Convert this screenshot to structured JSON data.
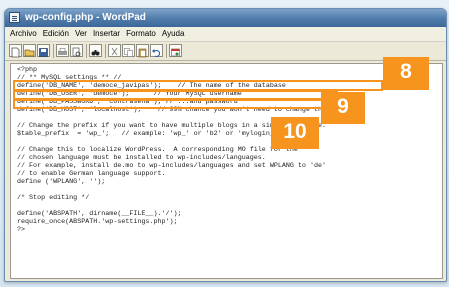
{
  "window": {
    "title": "wp-config.php - WordPad"
  },
  "menu": [
    "Archivo",
    "Edición",
    "Ver",
    "Insertar",
    "Formato",
    "Ayuda"
  ],
  "toolbar": {
    "icons": [
      "new-document-icon",
      "open-folder-icon",
      "save-icon",
      "print-icon",
      "print-preview-icon",
      "find-icon",
      "cut-icon",
      "copy-icon",
      "paste-icon",
      "undo-icon",
      "date-time-icon"
    ]
  },
  "code": {
    "lines": [
      "<?php",
      "// ** MySQL settings ** //",
      "define('DB_NAME', 'democe_javipas');    // The name of the database",
      "define('DB_USER', 'democe');      // Your MySQL username",
      "define('DB_PASSWORD', 'contraseña'); // ...and password",
      "define('DB_HOST', 'localhost');    // 99% chance you won't need to change this",
      "",
      "// Change the prefix if you want to have multiple blogs in a single database.",
      "$table_prefix  = 'wp_';   // example: 'wp_' or 'b2' or 'mylogin_'",
      "",
      "// Change this to localize WordPress.  A corresponding MO file for the",
      "// chosen language must be installed to wp-includes/languages.",
      "// For example, install de.mo to wp-includes/languages and set WPLANG to 'de'",
      "// to enable German language support.",
      "define ('WPLANG', '');",
      "",
      "/* Stop editing */",
      "",
      "define('ABSPATH', dirname(__FILE__).'/');",
      "require_once(ABSPATH.'wp-settings.php');",
      "?>"
    ]
  },
  "callouts": {
    "first": "8",
    "second": "9",
    "third": "10"
  },
  "colors": {
    "accent": "#f7941d",
    "title_bar": "#4f7bab"
  }
}
